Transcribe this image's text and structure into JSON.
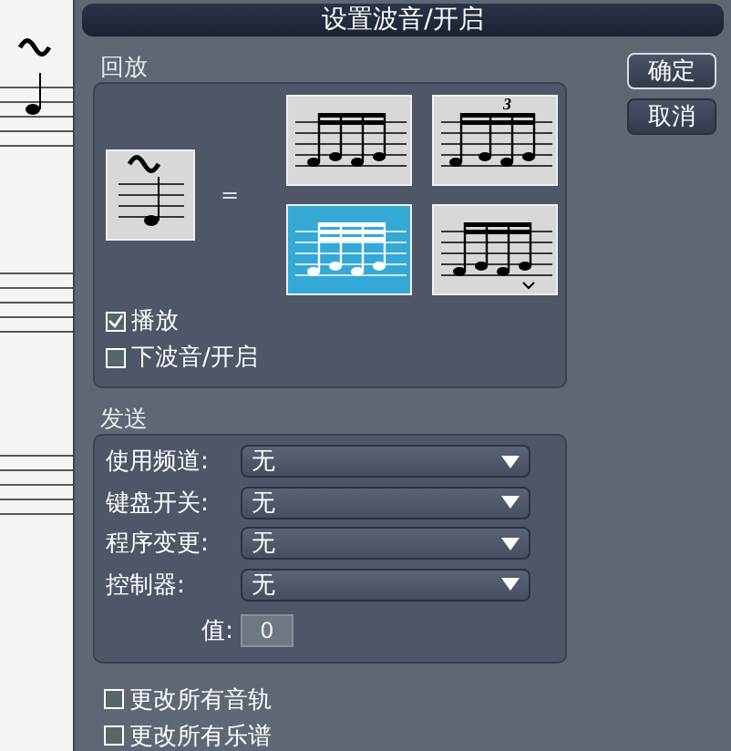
{
  "window": {
    "title": "设置波音/开启"
  },
  "buttons": [
    {
      "label": "确定",
      "default": true
    },
    {
      "label": "取消",
      "default": false
    }
  ],
  "playback": {
    "title": "回放",
    "equals": "=",
    "options": [
      {
        "kind": "sixteenths",
        "selected": false
      },
      {
        "kind": "triplet",
        "tuplet": "3",
        "selected": false
      },
      {
        "kind": "thirtyseconds",
        "selected": true
      },
      {
        "kind": "accented",
        "selected": false
      }
    ],
    "checks": [
      {
        "label": "播放",
        "checked": true
      },
      {
        "label": "下波音/开启",
        "checked": false
      }
    ]
  },
  "send": {
    "title": "发送",
    "rows": [
      {
        "label": "使用频道:",
        "value": "无"
      },
      {
        "label": "键盘开关:",
        "value": "无"
      },
      {
        "label": "程序变更:",
        "value": "无"
      },
      {
        "label": "控制器:",
        "value": "无"
      }
    ],
    "value_label": "值:",
    "value": "0"
  },
  "checks": [
    {
      "label": "更改所有音轨",
      "checked": false
    },
    {
      "label": "更改所有乐谱",
      "checked": false
    }
  ]
}
